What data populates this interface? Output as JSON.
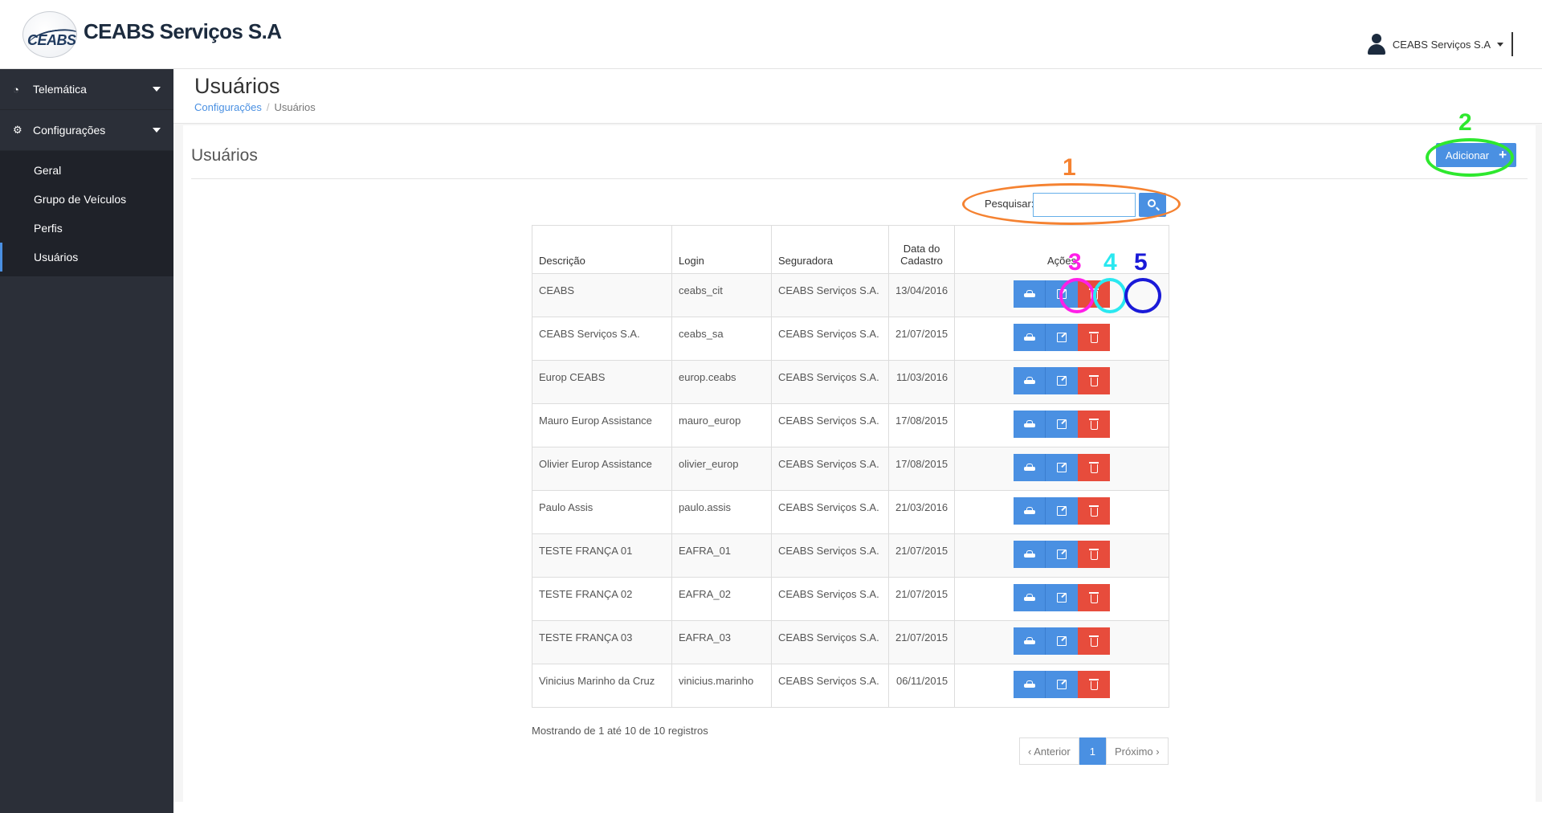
{
  "header": {
    "logo_text": "CEABS",
    "brand": "CEABS Serviços S.A",
    "user_name": "CEABS Serviços S.A"
  },
  "sidebar": {
    "sections": [
      {
        "label": "Telemática",
        "icon": "dashboard-icon"
      },
      {
        "label": "Configurações",
        "icon": "cogs-icon"
      }
    ],
    "sub_items": [
      {
        "label": "Geral"
      },
      {
        "label": "Grupo de Veículos"
      },
      {
        "label": "Perfis"
      },
      {
        "label": "Usuários",
        "active": true
      }
    ]
  },
  "page": {
    "title": "Usuários",
    "breadcrumb": {
      "parent": "Configurações",
      "sep": "/",
      "current": "Usuários"
    }
  },
  "panel": {
    "title": "Usuários",
    "add_label": "Adicionar",
    "search_label": "Pesquisar:",
    "search_value": ""
  },
  "table": {
    "headers": [
      "Descrição",
      "Login",
      "Seguradora",
      "Data do Cadastro",
      "Ações"
    ],
    "rows": [
      [
        "CEABS",
        "ceabs_cit",
        "CEABS Serviços S.A.",
        "13/04/2016"
      ],
      [
        "CEABS Serviços S.A.",
        "ceabs_sa",
        "CEABS Serviços S.A.",
        "21/07/2015"
      ],
      [
        "Europ CEABS",
        "europ.ceabs",
        "CEABS Serviços S.A.",
        "11/03/2016"
      ],
      [
        "Mauro Europ Assistance",
        "mauro_europ",
        "CEABS Serviços S.A.",
        "17/08/2015"
      ],
      [
        "Olivier Europ Assistance",
        "olivier_europ",
        "CEABS Serviços S.A.",
        "17/08/2015"
      ],
      [
        "Paulo Assis",
        "paulo.assis",
        "CEABS Serviços S.A.",
        "21/03/2016"
      ],
      [
        "TESTE FRANÇA 01",
        "EAFRA_01",
        "CEABS Serviços S.A.",
        "21/07/2015"
      ],
      [
        "TESTE FRANÇA 02",
        "EAFRA_02",
        "CEABS Serviços S.A.",
        "21/07/2015"
      ],
      [
        "TESTE FRANÇA 03",
        "EAFRA_03",
        "CEABS Serviços S.A.",
        "21/07/2015"
      ],
      [
        "Vinicius Marinho da Cruz",
        "vinicius.marinho",
        "CEABS Serviços S.A.",
        "06/11/2015"
      ]
    ],
    "action_icons": [
      "car-icon",
      "edit-icon",
      "trash-icon"
    ]
  },
  "footer": {
    "records_info": "Mostrando de 1 até 10 de 10 registros",
    "prev": "‹ Anterior",
    "current_page": "1",
    "next": "Próximo ›"
  },
  "annotations": [
    {
      "number": "1",
      "color": "#f58231"
    },
    {
      "number": "2",
      "color": "#2ee82e"
    },
    {
      "number": "3",
      "color": "#ff1fe8"
    },
    {
      "number": "4",
      "color": "#2ae8f0"
    },
    {
      "number": "5",
      "color": "#1a1ad8"
    }
  ],
  "colors": {
    "primary": "#4a90e2",
    "danger": "#e74c3c",
    "sidebar": "#2b2f38"
  }
}
